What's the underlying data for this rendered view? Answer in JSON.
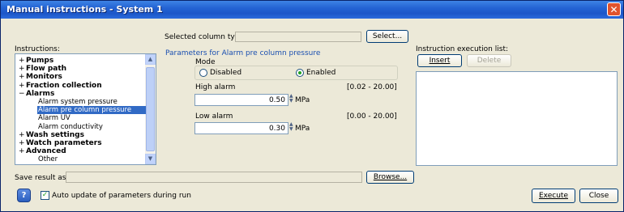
{
  "window": {
    "title": "Manual instructions - System 1",
    "close_glyph": "✕"
  },
  "left": {
    "instructions_label": "Instructions:",
    "tree": [
      {
        "label": "Pumps",
        "bold": true,
        "exp": "+"
      },
      {
        "label": "Flow path",
        "bold": true,
        "exp": "+"
      },
      {
        "label": "Monitors",
        "bold": true,
        "exp": "+"
      },
      {
        "label": "Fraction collection",
        "bold": true,
        "exp": "+"
      },
      {
        "label": "Alarms",
        "bold": true,
        "exp": "−"
      },
      {
        "label": "Alarm system pressure",
        "bold": false
      },
      {
        "label": "Alarm pre column pressure",
        "bold": false,
        "selected": true
      },
      {
        "label": "Alarm UV",
        "bold": false
      },
      {
        "label": "Alarm conductivity",
        "bold": false
      },
      {
        "label": "Wash settings",
        "bold": true,
        "exp": "+"
      },
      {
        "label": "Watch parameters",
        "bold": true,
        "exp": "+"
      },
      {
        "label": "Advanced",
        "bold": true,
        "exp": "+"
      },
      {
        "label": "Other",
        "bold": false
      }
    ]
  },
  "middle": {
    "column_type_label": "Selected column type:",
    "select_button": "Select...",
    "params_title": "Parameters for Alarm pre column pressure",
    "mode_label": "Mode",
    "disabled_label": "Disabled",
    "enabled_label": "Enabled",
    "selected_mode": "Enabled",
    "high_alarm_label": "High alarm",
    "high_alarm_range": "[0.02 - 20.00]",
    "high_alarm_value": "0.50",
    "high_alarm_unit": "MPa",
    "low_alarm_label": "Low alarm",
    "low_alarm_range": "[0.00 - 20.00]",
    "low_alarm_value": "0.30",
    "low_alarm_unit": "MPa"
  },
  "right": {
    "exec_list_label": "Instruction execution list:",
    "insert_button": "Insert",
    "delete_button": "Delete"
  },
  "bottom": {
    "save_result_label": "Save result as:",
    "browse_button": "Browse...",
    "auto_update_label": "Auto update of parameters during run",
    "auto_update_checked": true,
    "execute_button": "Execute",
    "close_button": "Close"
  }
}
